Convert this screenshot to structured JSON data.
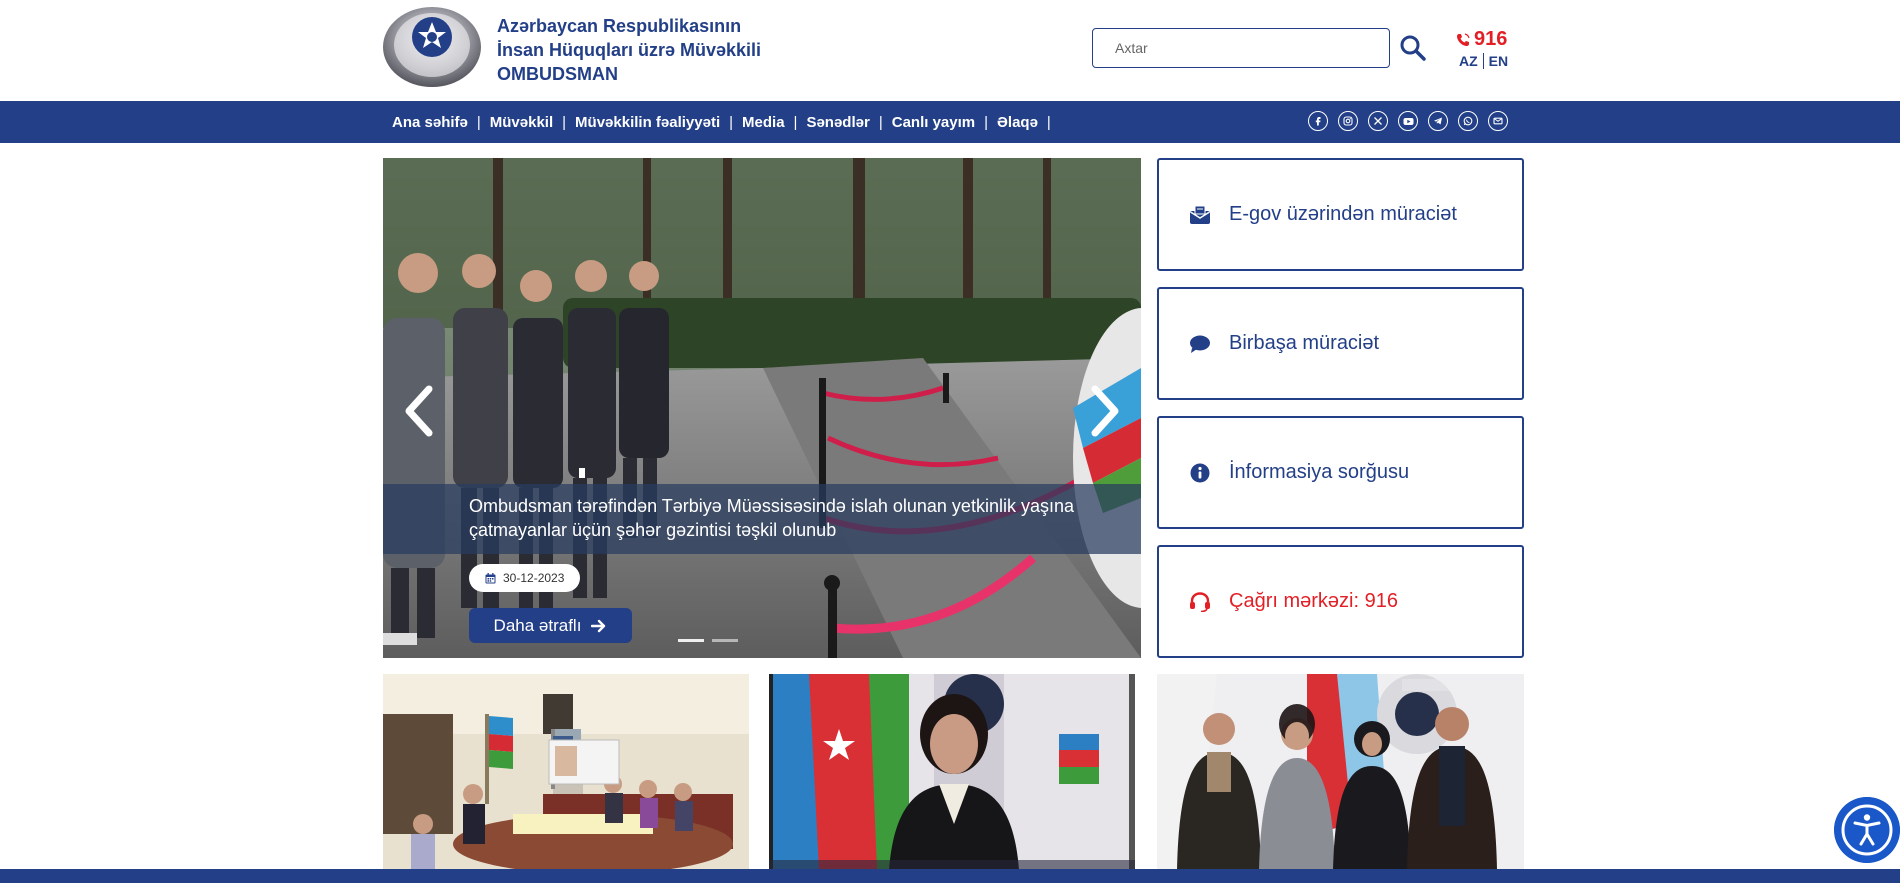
{
  "header": {
    "brand_line1": "Azərbaycan Respublikasının",
    "brand_line2": "İnsan Hüquqları üzrə Müvəkkili",
    "brand_line3": "OMBUDSMAN",
    "search_placeholder": "Axtar",
    "hotline": "916",
    "lang_az": "AZ",
    "lang_en": "EN"
  },
  "nav": {
    "items": [
      "Ana səhifə",
      "Müvəkkil",
      "Müvəkkilin fəaliyyəti",
      "Media",
      "Sənədlər",
      "Canlı yayım",
      "Əlaqə"
    ]
  },
  "socials": [
    "facebook-icon",
    "instagram-icon",
    "x-icon",
    "youtube-icon",
    "telegram-icon",
    "whatsapp-icon",
    "mail-icon"
  ],
  "slider": {
    "caption": "Ombudsman tərəfindən Tərbiyə Müəssisəsində islah olunan yetkinlik yaşına çatmayanlar üçün şəhər gəzintisi təşkil olunub",
    "date": "30-12-2023",
    "more_label": "Daha ətraflı"
  },
  "services": [
    {
      "label": "E-gov üzərindən müraciət",
      "icon": "egov-mail-icon"
    },
    {
      "label": "Birbaşa müraciət",
      "icon": "chat-bubble-icon"
    },
    {
      "label": "İnformasiya sorğusu",
      "icon": "info-icon"
    },
    {
      "label": "Çağrı mərkəzi: 916",
      "icon": "headset-icon"
    }
  ],
  "colors": {
    "primary": "#223f87",
    "accent_red": "#e31f26",
    "a11y_blue": "#1a57c9"
  }
}
